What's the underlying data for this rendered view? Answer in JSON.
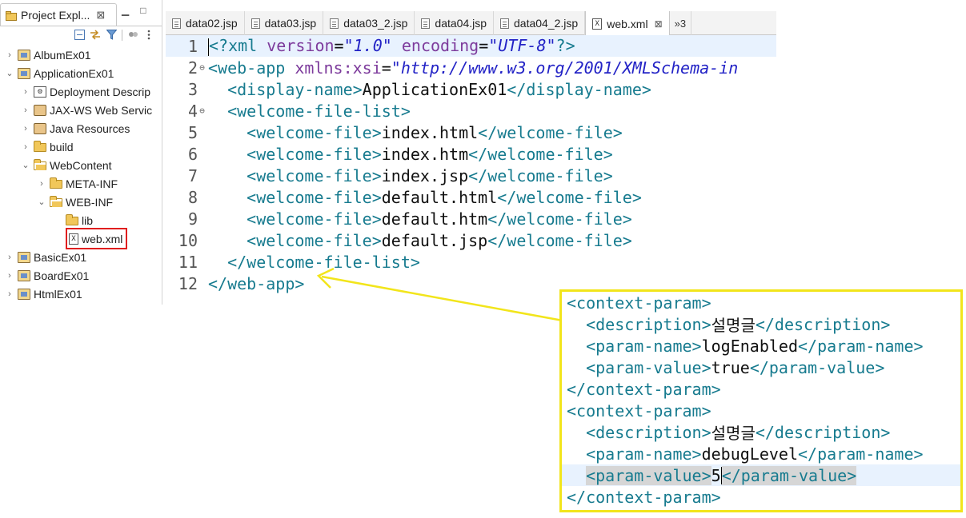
{
  "explorer": {
    "tab_title": "Project Expl...",
    "tab_close": "⊠",
    "tree": [
      {
        "label": "AlbumEx01",
        "indent": 0,
        "twisty": "›",
        "icon": "project"
      },
      {
        "label": "ApplicationEx01",
        "indent": 0,
        "twisty": "⌄",
        "icon": "project"
      },
      {
        "label": "Deployment Descrip",
        "indent": 1,
        "twisty": "›",
        "icon": "dd"
      },
      {
        "label": "JAX-WS Web Servic",
        "indent": 1,
        "twisty": "›",
        "icon": "jar"
      },
      {
        "label": "Java Resources",
        "indent": 1,
        "twisty": "›",
        "icon": "jar"
      },
      {
        "label": "build",
        "indent": 1,
        "twisty": "›",
        "icon": "folder"
      },
      {
        "label": "WebContent",
        "indent": 1,
        "twisty": "⌄",
        "icon": "folder-open"
      },
      {
        "label": "META-INF",
        "indent": 2,
        "twisty": "›",
        "icon": "folder"
      },
      {
        "label": "WEB-INF",
        "indent": 2,
        "twisty": "⌄",
        "icon": "folder-open"
      },
      {
        "label": "lib",
        "indent": 3,
        "twisty": "",
        "icon": "folder"
      },
      {
        "label": "web.xml",
        "indent": 3,
        "twisty": "",
        "icon": "xml",
        "selected": true
      },
      {
        "label": "BasicEx01",
        "indent": 0,
        "twisty": "›",
        "icon": "project"
      },
      {
        "label": "BoardEx01",
        "indent": 0,
        "twisty": "›",
        "icon": "project"
      },
      {
        "label": "HtmlEx01",
        "indent": 0,
        "twisty": "›",
        "icon": "project"
      }
    ]
  },
  "editor": {
    "tabs": [
      {
        "label": "data02.jsp",
        "active": false
      },
      {
        "label": "data03.jsp",
        "active": false
      },
      {
        "label": "data03_2.jsp",
        "active": false
      },
      {
        "label": "data04.jsp",
        "active": false
      },
      {
        "label": "data04_2.jsp",
        "active": false
      },
      {
        "label": "web.xml",
        "active": true
      }
    ],
    "overflow_label": "»3",
    "lines": [
      {
        "num": "1",
        "fold": "",
        "parts": [
          [
            "pi",
            "<?xml "
          ],
          [
            "attr",
            "version"
          ],
          [
            "txt",
            "="
          ],
          [
            "str",
            "\"1.0\""
          ],
          [
            "txt",
            " "
          ],
          [
            "attr",
            "encoding"
          ],
          [
            "txt",
            "="
          ],
          [
            "str",
            "\"UTF-8\""
          ],
          [
            "pi",
            "?>"
          ]
        ]
      },
      {
        "num": "2",
        "fold": "⊖",
        "parts": [
          [
            "tag",
            "<web-app "
          ],
          [
            "attr",
            "xmlns:xsi"
          ],
          [
            "txt",
            "="
          ],
          [
            "str",
            "\"http://www.w3.org/2001/XMLSchema-in"
          ]
        ]
      },
      {
        "num": "3",
        "fold": "",
        "parts": [
          [
            "txt",
            "  "
          ],
          [
            "tag",
            "<display-name>"
          ],
          [
            "txt",
            "ApplicationEx01"
          ],
          [
            "tag",
            "</display-name>"
          ]
        ]
      },
      {
        "num": "4",
        "fold": "⊖",
        "parts": [
          [
            "txt",
            "  "
          ],
          [
            "tag",
            "<welcome-file-list>"
          ]
        ]
      },
      {
        "num": "5",
        "fold": "",
        "parts": [
          [
            "txt",
            "    "
          ],
          [
            "tag",
            "<welcome-file>"
          ],
          [
            "txt",
            "index.html"
          ],
          [
            "tag",
            "</welcome-file>"
          ]
        ]
      },
      {
        "num": "6",
        "fold": "",
        "parts": [
          [
            "txt",
            "    "
          ],
          [
            "tag",
            "<welcome-file>"
          ],
          [
            "txt",
            "index.htm"
          ],
          [
            "tag",
            "</welcome-file>"
          ]
        ]
      },
      {
        "num": "7",
        "fold": "",
        "parts": [
          [
            "txt",
            "    "
          ],
          [
            "tag",
            "<welcome-file>"
          ],
          [
            "txt",
            "index.jsp"
          ],
          [
            "tag",
            "</welcome-file>"
          ]
        ]
      },
      {
        "num": "8",
        "fold": "",
        "parts": [
          [
            "txt",
            "    "
          ],
          [
            "tag",
            "<welcome-file>"
          ],
          [
            "txt",
            "default.html"
          ],
          [
            "tag",
            "</welcome-file>"
          ]
        ]
      },
      {
        "num": "9",
        "fold": "",
        "parts": [
          [
            "txt",
            "    "
          ],
          [
            "tag",
            "<welcome-file>"
          ],
          [
            "txt",
            "default.htm"
          ],
          [
            "tag",
            "</welcome-file>"
          ]
        ]
      },
      {
        "num": "10",
        "fold": "",
        "parts": [
          [
            "txt",
            "    "
          ],
          [
            "tag",
            "<welcome-file>"
          ],
          [
            "txt",
            "default.jsp"
          ],
          [
            "tag",
            "</welcome-file>"
          ]
        ]
      },
      {
        "num": "11",
        "fold": "",
        "parts": [
          [
            "txt",
            "  "
          ],
          [
            "tag",
            "</welcome-file-list>"
          ]
        ]
      },
      {
        "num": "12",
        "fold": "",
        "parts": [
          [
            "tag",
            "</web-app>"
          ]
        ]
      }
    ]
  },
  "callout": {
    "lines": [
      {
        "parts": [
          [
            "tag",
            "<context-param>"
          ]
        ]
      },
      {
        "parts": [
          [
            "txt",
            "  "
          ],
          [
            "tag",
            "<description>"
          ],
          [
            "txt",
            "설명글"
          ],
          [
            "tag",
            "</description>"
          ]
        ]
      },
      {
        "parts": [
          [
            "txt",
            "  "
          ],
          [
            "tag",
            "<param-name>"
          ],
          [
            "txt",
            "logEnabled"
          ],
          [
            "tag",
            "</param-name>"
          ]
        ]
      },
      {
        "parts": [
          [
            "txt",
            "  "
          ],
          [
            "tag",
            "<param-value>"
          ],
          [
            "txt",
            "true"
          ],
          [
            "tag",
            "</param-value>"
          ]
        ]
      },
      {
        "parts": [
          [
            "tag",
            "</context-param>"
          ]
        ]
      },
      {
        "parts": [
          [
            "tag",
            "<context-param>"
          ]
        ]
      },
      {
        "parts": [
          [
            "txt",
            "  "
          ],
          [
            "tag",
            "<description>"
          ],
          [
            "txt",
            "설명글"
          ],
          [
            "tag",
            "</description>"
          ]
        ]
      },
      {
        "parts": [
          [
            "txt",
            "  "
          ],
          [
            "tag",
            "<param-name>"
          ],
          [
            "txt",
            "debugLevel"
          ],
          [
            "tag",
            "</param-name>"
          ]
        ]
      },
      {
        "parts": [
          [
            "txt",
            "  "
          ],
          [
            "tagmark",
            "<param-value>"
          ],
          [
            "txt",
            "5"
          ],
          [
            "caret",
            ""
          ],
          [
            "tagmark",
            "</param-value>"
          ]
        ],
        "highlight": true
      },
      {
        "parts": [
          [
            "tag",
            "</context-param>"
          ]
        ]
      }
    ]
  },
  "colors": {
    "tag": "#177b8f",
    "attr": "#7d3b9c",
    "string": "#2323c6",
    "callout_border": "#f2e51b",
    "selection_border": "#e01e1e"
  }
}
